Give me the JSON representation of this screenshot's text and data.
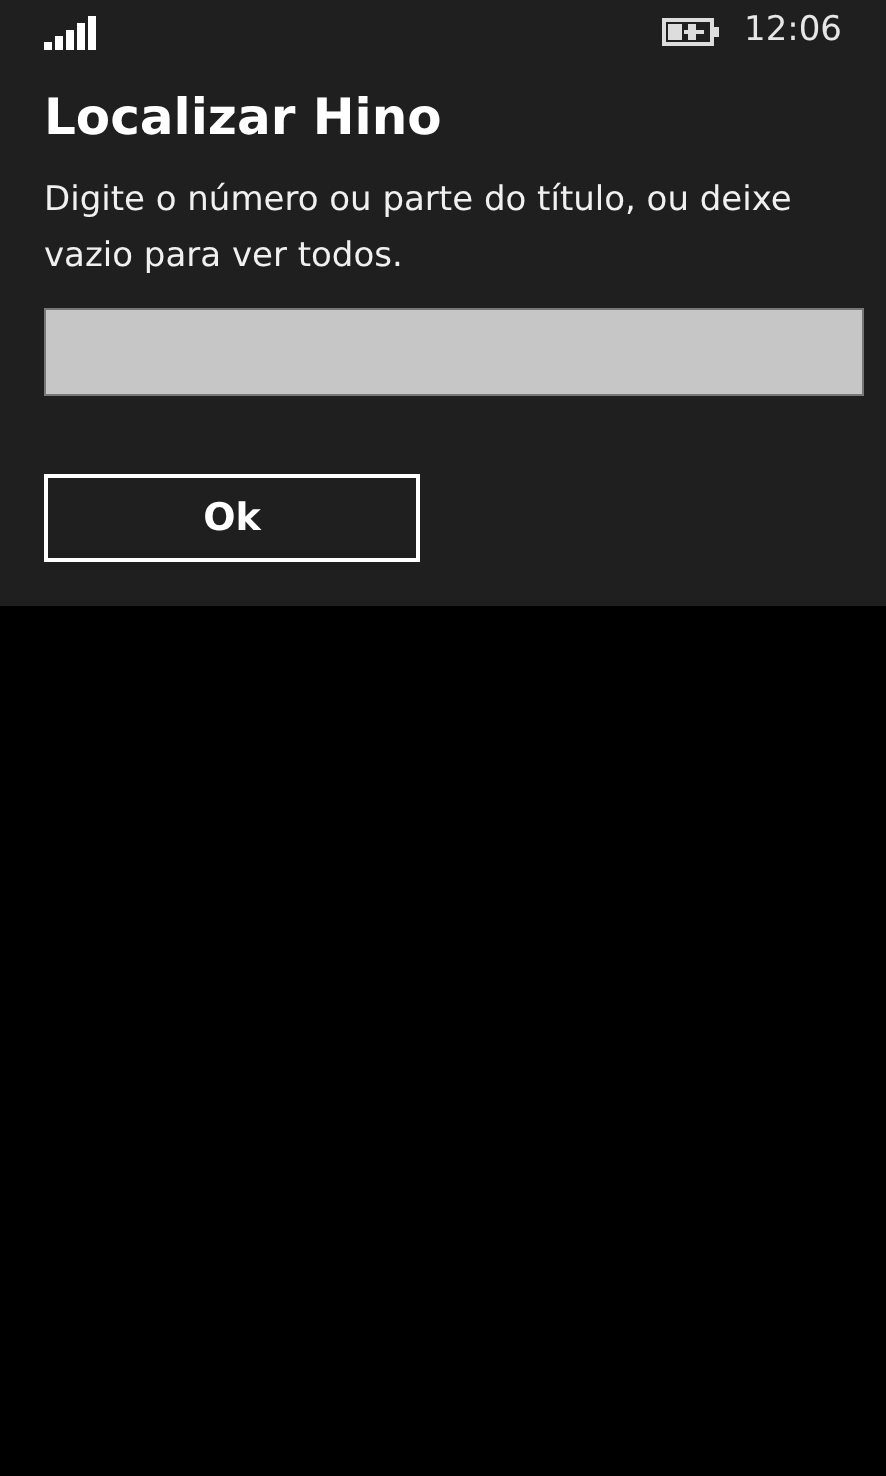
{
  "status_bar": {
    "time": "12:06"
  },
  "title": "Localizar Hino",
  "description": "Digite o número ou parte do título, ou deixe vazio para ver todos.",
  "button": {
    "label": "Ok"
  }
}
